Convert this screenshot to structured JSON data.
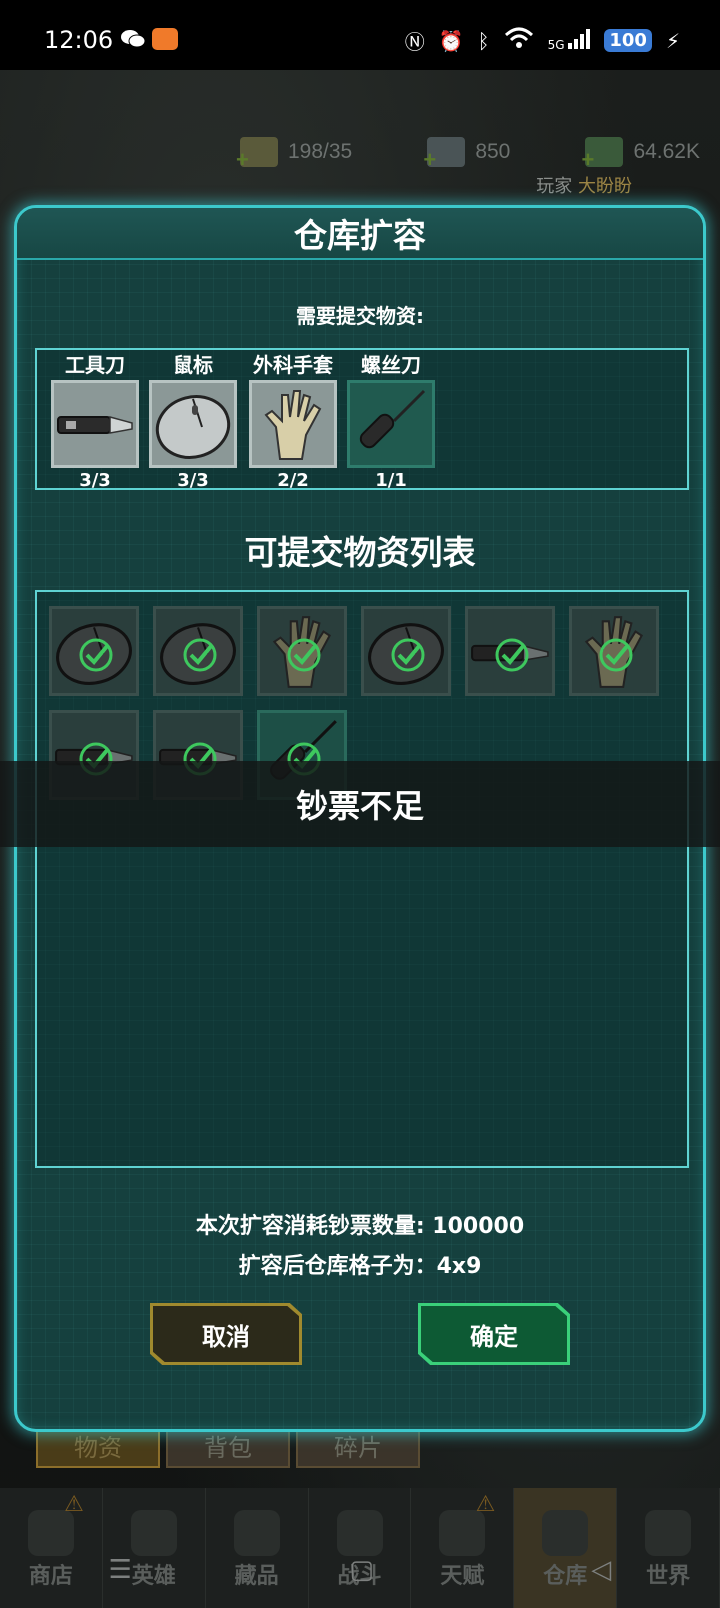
{
  "status_bar": {
    "time": "12:06",
    "network": "5G",
    "battery": "100",
    "icons": [
      "wechat-icon",
      "app-notification-icon",
      "nfc-icon",
      "alarm-icon",
      "bluetooth-icon",
      "wifi-icon",
      "signal-icon",
      "charging-icon"
    ]
  },
  "resources": {
    "stamina": "198/35",
    "diamonds": "850",
    "cash": "64.62K"
  },
  "player": {
    "label": "玩家",
    "name": "大盼盼"
  },
  "dialog": {
    "title": "仓库扩容",
    "required_label": "需要提交物资:",
    "required_items": [
      {
        "name": "工具刀",
        "count": "3/3",
        "icon": "utility-knife-icon"
      },
      {
        "name": "鼠标",
        "count": "3/3",
        "icon": "mouse-icon"
      },
      {
        "name": "外科手套",
        "count": "2/2",
        "icon": "glove-icon"
      },
      {
        "name": "螺丝刀",
        "count": "1/1",
        "icon": "screwdriver-icon"
      }
    ],
    "list_title": "可提交物资列表",
    "list_items": [
      {
        "icon": "mouse-icon",
        "checked": true
      },
      {
        "icon": "mouse-icon",
        "checked": true
      },
      {
        "icon": "glove-icon",
        "checked": true
      },
      {
        "icon": "mouse-icon",
        "checked": true
      },
      {
        "icon": "utility-knife-icon",
        "checked": true
      },
      {
        "icon": "glove-icon",
        "checked": true
      },
      {
        "icon": "utility-knife-icon",
        "checked": true
      },
      {
        "icon": "utility-knife-icon",
        "checked": true
      },
      {
        "icon": "screwdriver-icon",
        "checked": true
      }
    ],
    "cost_text": "本次扩容消耗钞票数量: 100000",
    "result_text": "扩容后仓库格子为：4x9",
    "cancel_label": "取消",
    "confirm_label": "确定"
  },
  "toast": "钞票不足",
  "sub_tabs": [
    "物资",
    "背包",
    "碎片"
  ],
  "bottom_nav": [
    {
      "label": "商店",
      "warn": true
    },
    {
      "label": "英雄",
      "warn": false
    },
    {
      "label": "藏品",
      "warn": false
    },
    {
      "label": "战斗",
      "warn": false
    },
    {
      "label": "天赋",
      "warn": true
    },
    {
      "label": "仓库",
      "warn": false
    },
    {
      "label": "世界",
      "warn": false
    }
  ],
  "colors": {
    "dialog_border": "#3cc9cc",
    "dialog_bg": "#15403e",
    "cancel_border": "#a08a2e",
    "confirm_border": "#3ad07a",
    "check": "#3ec85e"
  }
}
